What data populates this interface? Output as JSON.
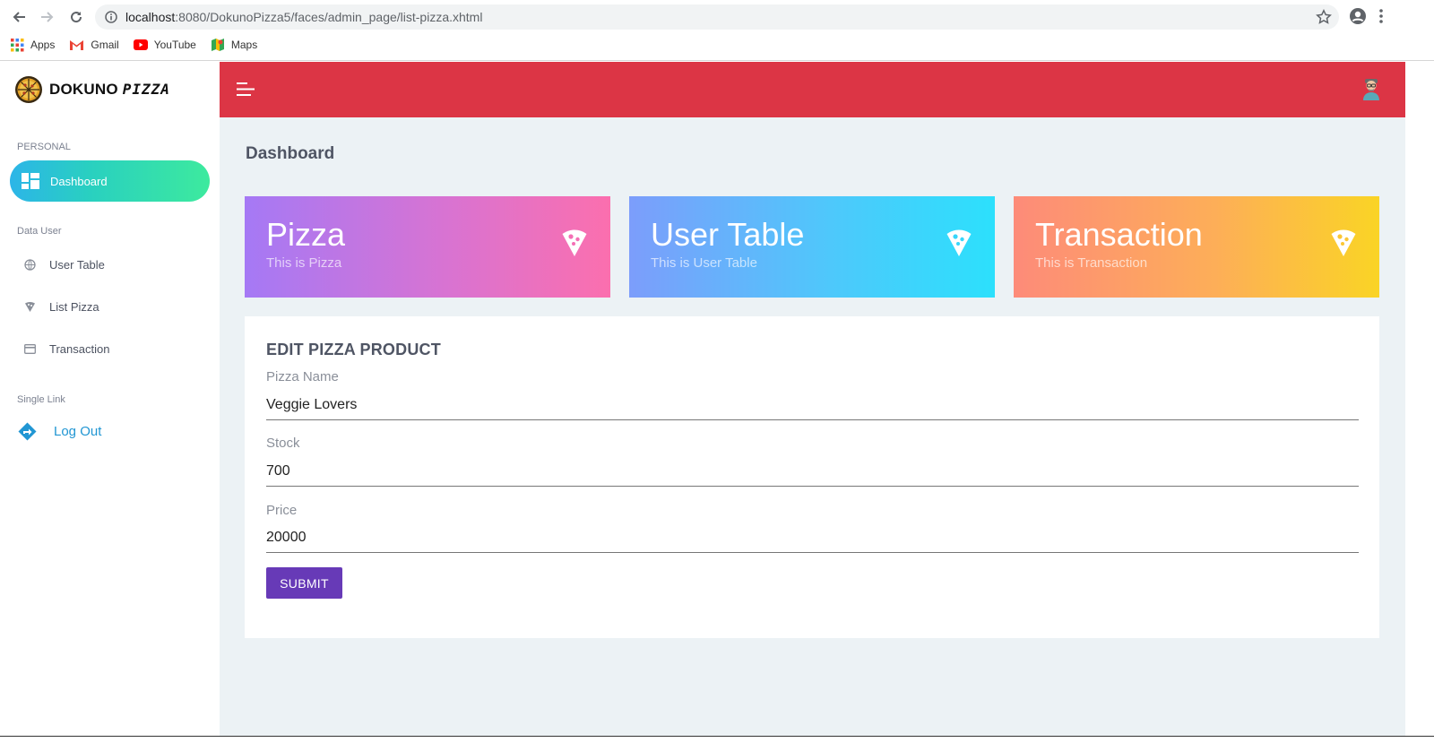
{
  "browser": {
    "url_host": "localhost",
    "url_rest": ":8080/DokunoPizza5/faces/admin_page/list-pizza.xhtml",
    "bookmarks": [
      "Apps",
      "Gmail",
      "YouTube",
      "Maps"
    ]
  },
  "brand": {
    "name_plain": "DOKUNO",
    "name_styled": "PIZZA"
  },
  "sidebar": {
    "section_personal": "PERSONAL",
    "active_item": "Dashboard",
    "section_data_user": "Data User",
    "items": [
      {
        "label": "User Table",
        "icon": "globe-icon"
      },
      {
        "label": "List Pizza",
        "icon": "pizza-icon"
      },
      {
        "label": "Transaction",
        "icon": "card-icon"
      }
    ],
    "section_single_link": "Single Link",
    "logout": "Log Out"
  },
  "main": {
    "title": "Dashboard",
    "cards": [
      {
        "title": "Pizza",
        "subtitle": "This is Pizza"
      },
      {
        "title": "User Table",
        "subtitle": "This is User Table"
      },
      {
        "title": "Transaction",
        "subtitle": "This is Transaction"
      }
    ],
    "form": {
      "title": "EDIT PIZZA PRODUCT",
      "fields": [
        {
          "label": "Pizza Name",
          "value": "Veggie Lovers"
        },
        {
          "label": "Stock",
          "value": "700"
        },
        {
          "label": "Price",
          "value": "20000"
        }
      ],
      "submit_label": "SUBMIT"
    }
  },
  "colors": {
    "topbar": "#dc3545",
    "submit": "#673ab7",
    "logout": "#2196d3"
  }
}
